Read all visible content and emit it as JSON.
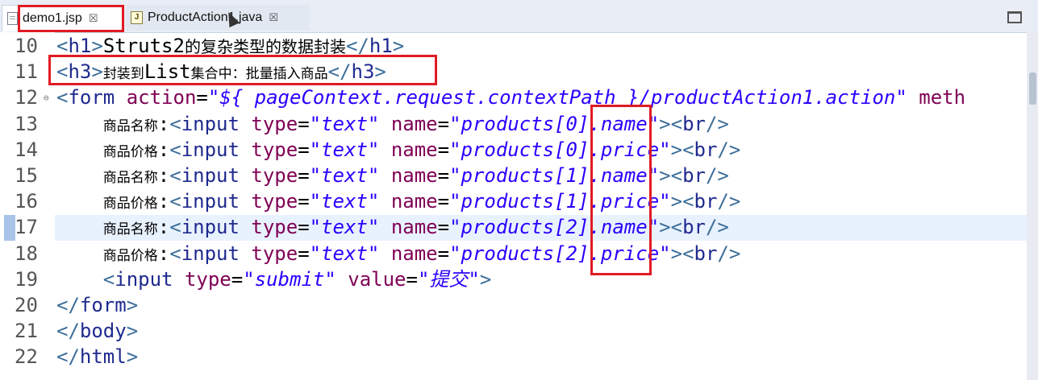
{
  "tabs": [
    {
      "label": "demo1.jsp",
      "close": "☒",
      "active": true
    },
    {
      "label": "ProductAction1.java",
      "close": "☒",
      "active": false
    }
  ],
  "lines": [
    {
      "num": "10",
      "parts": [
        [
          "tag",
          "<"
        ],
        [
          "tname",
          "h1"
        ],
        [
          "tag",
          ">"
        ],
        [
          "txt",
          "Struts2"
        ],
        [
          "cjk-b",
          "的复杂类型的数据封装"
        ],
        [
          "tag",
          "</"
        ],
        [
          "tname",
          "h1"
        ],
        [
          "tag",
          ">"
        ]
      ]
    },
    {
      "num": "11",
      "parts": [
        [
          "tag",
          "<"
        ],
        [
          "tname",
          "h3"
        ],
        [
          "tag",
          ">"
        ],
        [
          "cjk",
          "封装到"
        ],
        [
          "txt",
          "List"
        ],
        [
          "cjk",
          "集合中：批量插入商品"
        ],
        [
          "tag",
          "</"
        ],
        [
          "tname",
          "h3"
        ],
        [
          "tag",
          ">"
        ]
      ]
    },
    {
      "num": "12",
      "fold": "⊖",
      "parts": [
        [
          "tag",
          "<"
        ],
        [
          "tname",
          "form"
        ],
        [
          "txt",
          " "
        ],
        [
          "attr",
          "action"
        ],
        [
          "txt",
          "="
        ],
        [
          "str",
          "\"${ pageContext.request.contextPath }/productAction1.action\""
        ],
        [
          "txt",
          " "
        ],
        [
          "attr",
          "meth"
        ]
      ]
    },
    {
      "num": "13",
      "parts": [
        [
          "txt",
          "    "
        ],
        [
          "cjk",
          "商品名称"
        ],
        [
          "txt",
          ":"
        ],
        [
          "tag",
          "<"
        ],
        [
          "tname",
          "input"
        ],
        [
          "txt",
          " "
        ],
        [
          "attr",
          "type"
        ],
        [
          "txt",
          "="
        ],
        [
          "str",
          "\"text\""
        ],
        [
          "txt",
          " "
        ],
        [
          "attr",
          "name"
        ],
        [
          "txt",
          "="
        ],
        [
          "str",
          "\"products[0].name\""
        ],
        [
          "tag",
          ">"
        ],
        [
          "tag",
          "<"
        ],
        [
          "tname",
          "br"
        ],
        [
          "tag",
          "/>"
        ]
      ]
    },
    {
      "num": "14",
      "parts": [
        [
          "txt",
          "    "
        ],
        [
          "cjk",
          "商品价格"
        ],
        [
          "txt",
          ":"
        ],
        [
          "tag",
          "<"
        ],
        [
          "tname",
          "input"
        ],
        [
          "txt",
          " "
        ],
        [
          "attr",
          "type"
        ],
        [
          "txt",
          "="
        ],
        [
          "str",
          "\"text\""
        ],
        [
          "txt",
          " "
        ],
        [
          "attr",
          "name"
        ],
        [
          "txt",
          "="
        ],
        [
          "str",
          "\"products[0].price\""
        ],
        [
          "tag",
          ">"
        ],
        [
          "tag",
          "<"
        ],
        [
          "tname",
          "br"
        ],
        [
          "tag",
          "/>"
        ]
      ]
    },
    {
      "num": "15",
      "parts": [
        [
          "txt",
          "    "
        ],
        [
          "cjk",
          "商品名称"
        ],
        [
          "txt",
          ":"
        ],
        [
          "tag",
          "<"
        ],
        [
          "tname",
          "input"
        ],
        [
          "txt",
          " "
        ],
        [
          "attr",
          "type"
        ],
        [
          "txt",
          "="
        ],
        [
          "str",
          "\"text\""
        ],
        [
          "txt",
          " "
        ],
        [
          "attr",
          "name"
        ],
        [
          "txt",
          "="
        ],
        [
          "str",
          "\"products[1].name\""
        ],
        [
          "tag",
          ">"
        ],
        [
          "tag",
          "<"
        ],
        [
          "tname",
          "br"
        ],
        [
          "tag",
          "/>"
        ]
      ]
    },
    {
      "num": "16",
      "parts": [
        [
          "txt",
          "    "
        ],
        [
          "cjk",
          "商品价格"
        ],
        [
          "txt",
          ":"
        ],
        [
          "tag",
          "<"
        ],
        [
          "tname",
          "input"
        ],
        [
          "txt",
          " "
        ],
        [
          "attr",
          "type"
        ],
        [
          "txt",
          "="
        ],
        [
          "str",
          "\"text\""
        ],
        [
          "txt",
          " "
        ],
        [
          "attr",
          "name"
        ],
        [
          "txt",
          "="
        ],
        [
          "str",
          "\"products[1].price\""
        ],
        [
          "tag",
          ">"
        ],
        [
          "tag",
          "<"
        ],
        [
          "tname",
          "br"
        ],
        [
          "tag",
          "/>"
        ]
      ]
    },
    {
      "num": "17",
      "parts": [
        [
          "txt",
          "    "
        ],
        [
          "cjk",
          "商品名称"
        ],
        [
          "txt",
          ":"
        ],
        [
          "tag",
          "<"
        ],
        [
          "tname",
          "input"
        ],
        [
          "txt",
          " "
        ],
        [
          "attr",
          "type"
        ],
        [
          "txt",
          "="
        ],
        [
          "str",
          "\"text\""
        ],
        [
          "txt",
          " "
        ],
        [
          "attr",
          "name"
        ],
        [
          "txt",
          "="
        ],
        [
          "str",
          "\"products[2].name\""
        ],
        [
          "tag",
          ">"
        ],
        [
          "tag",
          "<"
        ],
        [
          "tname",
          "br"
        ],
        [
          "tag",
          "/>"
        ]
      ]
    },
    {
      "num": "18",
      "parts": [
        [
          "txt",
          "    "
        ],
        [
          "cjk",
          "商品价格"
        ],
        [
          "txt",
          ":"
        ],
        [
          "tag",
          "<"
        ],
        [
          "tname",
          "input"
        ],
        [
          "txt",
          " "
        ],
        [
          "attr",
          "type"
        ],
        [
          "txt",
          "="
        ],
        [
          "str",
          "\"text\""
        ],
        [
          "txt",
          " "
        ],
        [
          "attr",
          "name"
        ],
        [
          "txt",
          "="
        ],
        [
          "str",
          "\"products[2].price\""
        ],
        [
          "tag",
          ">"
        ],
        [
          "tag",
          "<"
        ],
        [
          "tname",
          "br"
        ],
        [
          "tag",
          "/>"
        ]
      ]
    },
    {
      "num": "19",
      "parts": [
        [
          "txt",
          "    "
        ],
        [
          "tag",
          "<"
        ],
        [
          "tname",
          "input"
        ],
        [
          "txt",
          " "
        ],
        [
          "attr",
          "type"
        ],
        [
          "txt",
          "="
        ],
        [
          "str",
          "\"submit\""
        ],
        [
          "txt",
          " "
        ],
        [
          "attr",
          "value"
        ],
        [
          "txt",
          "="
        ],
        [
          "str",
          "\"提交\""
        ],
        [
          "tag",
          ">"
        ]
      ]
    },
    {
      "num": "20",
      "parts": [
        [
          "tag",
          "</"
        ],
        [
          "tname",
          "form"
        ],
        [
          "tag",
          ">"
        ]
      ]
    },
    {
      "num": "21",
      "parts": [
        [
          "tag",
          "</"
        ],
        [
          "tname",
          "body"
        ],
        [
          "tag",
          ">"
        ]
      ]
    },
    {
      "num": "22",
      "parts": [
        [
          "tag",
          "</"
        ],
        [
          "tname",
          "html"
        ],
        [
          "tag",
          ">"
        ]
      ]
    }
  ],
  "colors": {
    "highlight_box": "#e01b24",
    "current_line": "#e8f2fe"
  }
}
